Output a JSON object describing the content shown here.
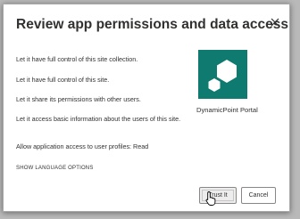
{
  "dialog": {
    "title": "Review app permissions and data access",
    "close_icon": "close-icon",
    "permissions": [
      "Let it have full control of this site collection.",
      "Let it have full control of this site.",
      "Let it share its permissions with other users.",
      "Let it access basic information about the users of this site.",
      "Allow application access to user profiles: Read"
    ],
    "language_link": "SHOW LANGUAGE OPTIONS",
    "app": {
      "name": "DynamicPoint Portal",
      "logo_color": "#0e7a70"
    },
    "buttons": {
      "trust": "Trust It",
      "cancel": "Cancel"
    }
  }
}
